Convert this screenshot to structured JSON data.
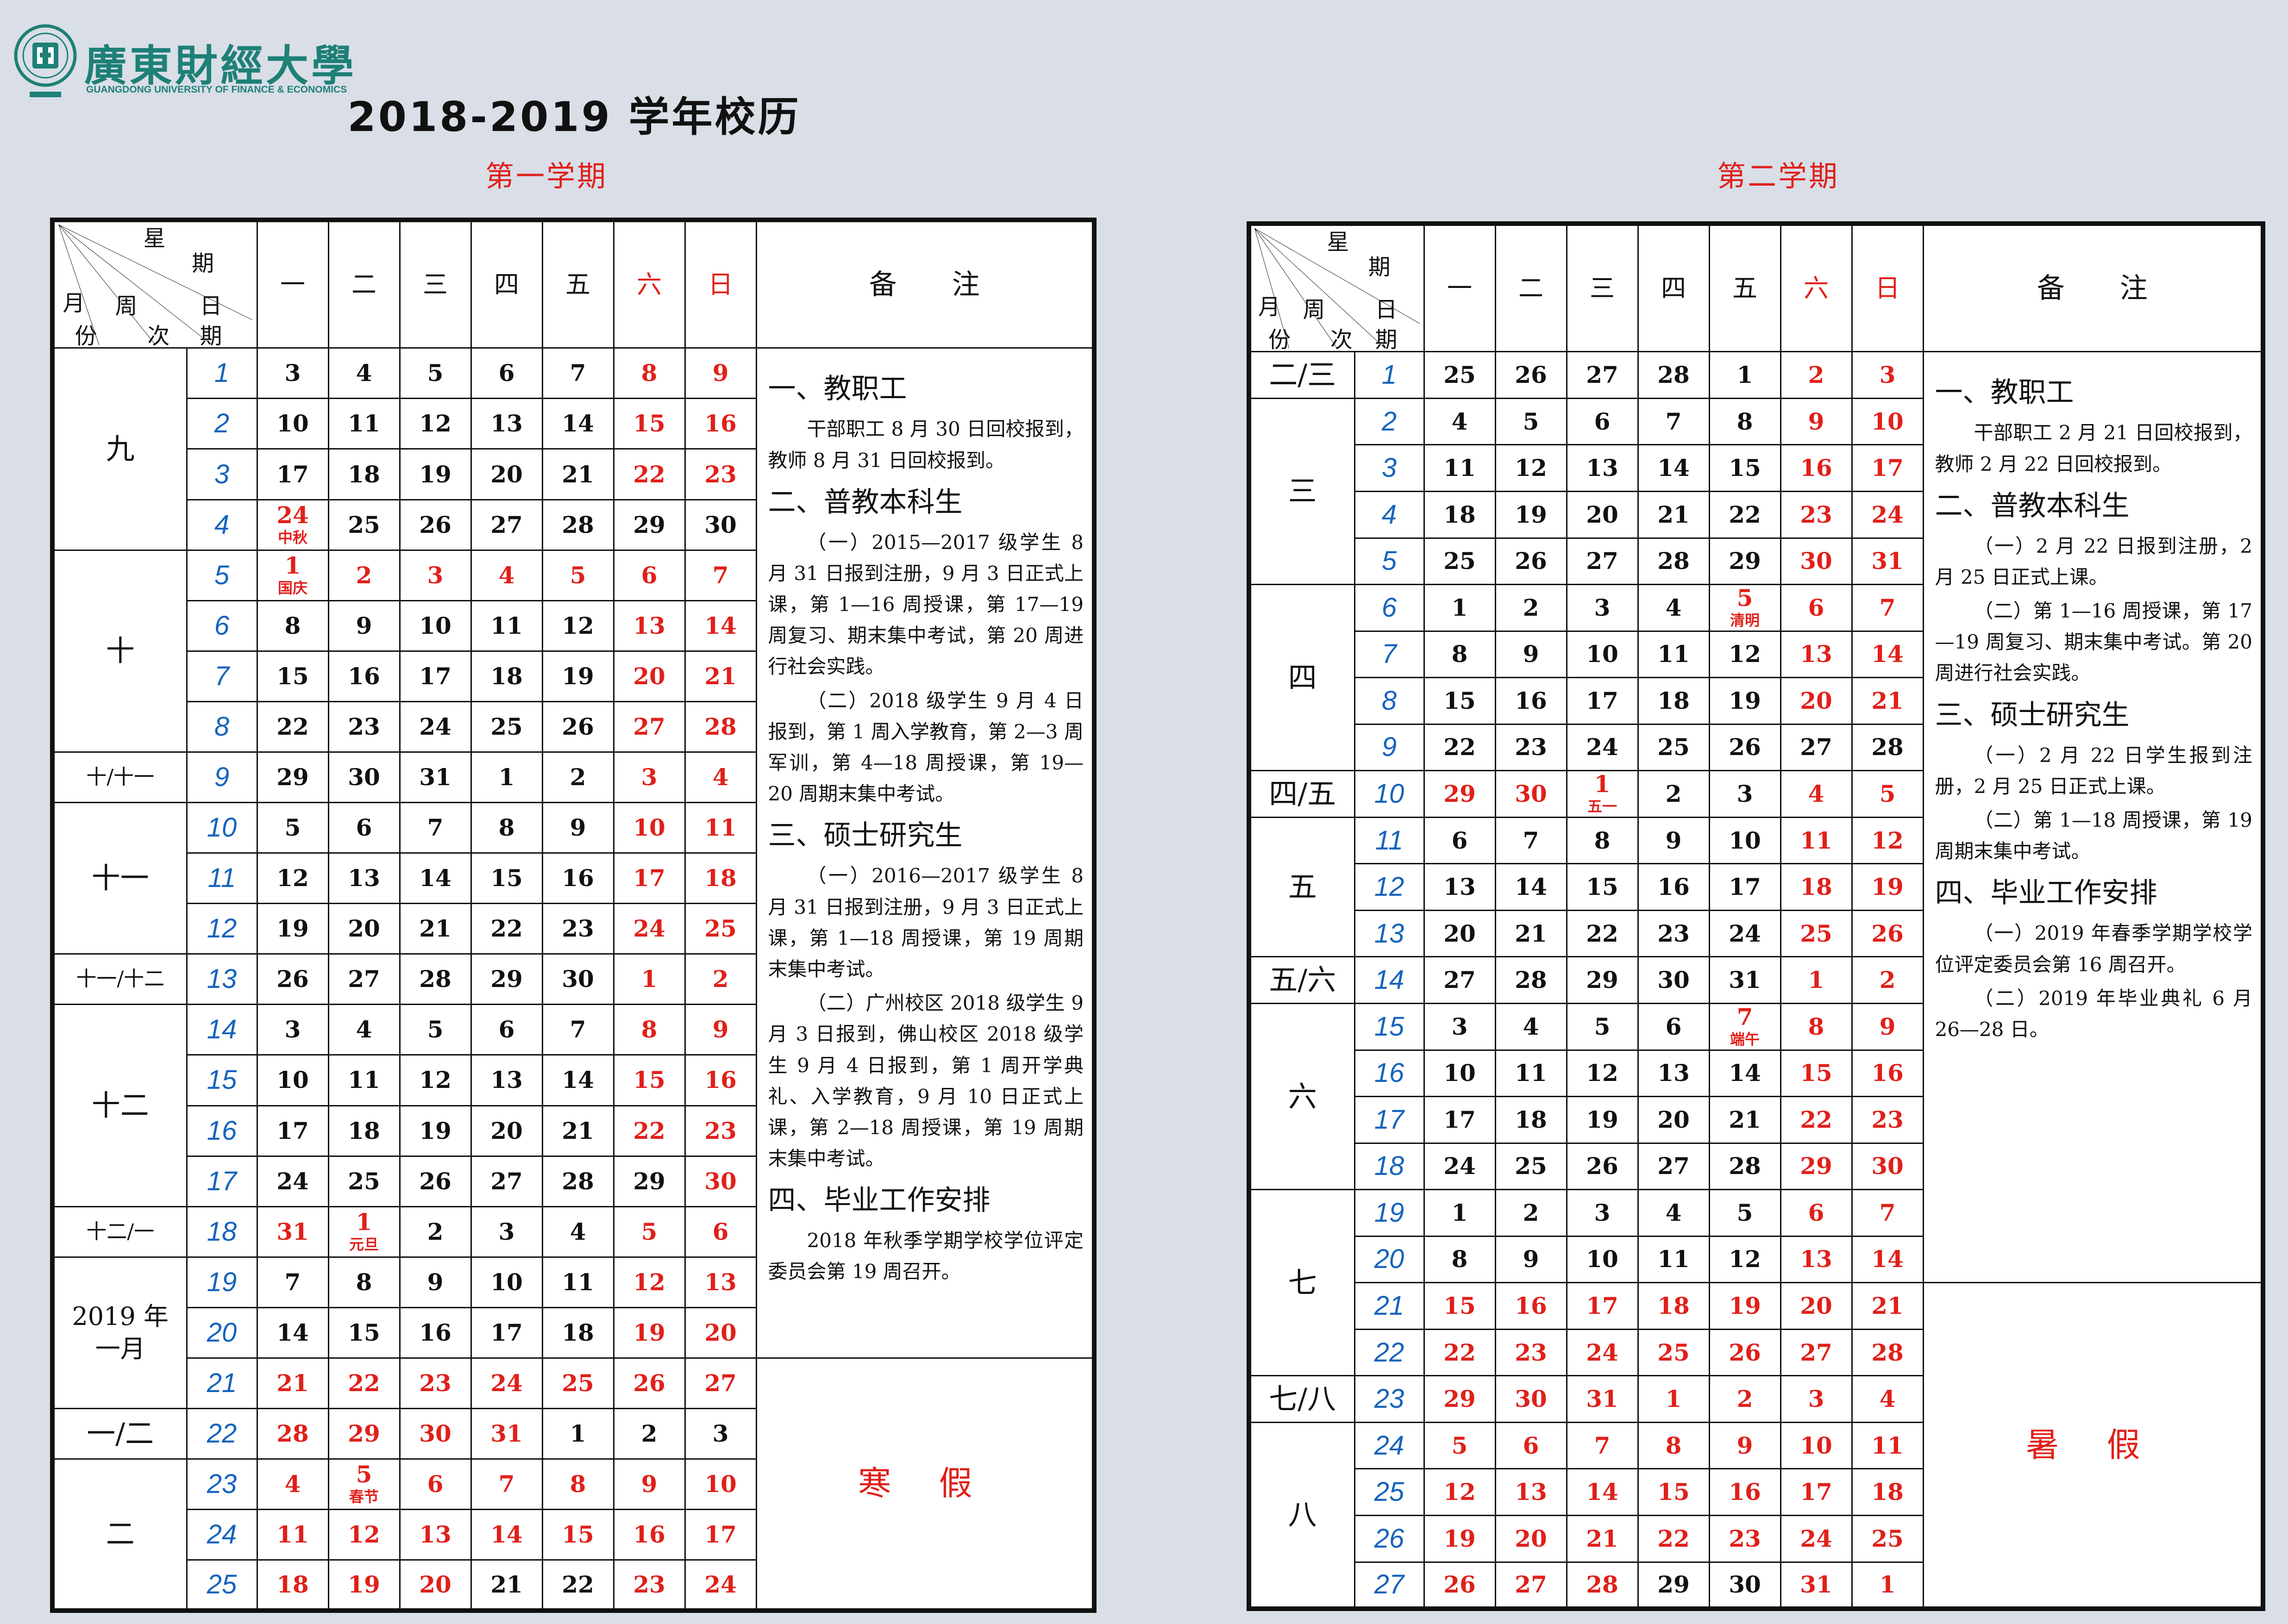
{
  "logo": {
    "cn": "廣東財經大學",
    "en": "GUANGDONG UNIVERSITY OF FINANCE & ECONOMICS",
    "seal_text": "廣東財經大學 1983"
  },
  "title": "2018-2019 学年校历",
  "header": {
    "corner": {
      "xing": "星",
      "qi": "期",
      "ri": "日",
      "yue": "月",
      "fen": "份",
      "zhou": "周",
      "ci": "次",
      "qi2": "期"
    },
    "days": [
      "一",
      "二",
      "三",
      "四",
      "五",
      "六",
      "日"
    ],
    "notes": "备 注"
  },
  "colors": {
    "red": "#e0201a",
    "week_blue": "#1564bd",
    "logo_teal": "#1e8077",
    "text": "#111111",
    "page_bg": "#d9dee7"
  },
  "sem1": {
    "title": "第一学期",
    "rows": [
      {
        "month": "九",
        "week": "1",
        "days": [
          "3",
          "4",
          "5",
          "6",
          "7",
          "8",
          "9"
        ],
        "red": [
          5,
          6
        ]
      },
      {
        "week": "2",
        "days": [
          "10",
          "11",
          "12",
          "13",
          "14",
          "15",
          "16"
        ],
        "red": [
          5,
          6
        ]
      },
      {
        "week": "3",
        "days": [
          "17",
          "18",
          "19",
          "20",
          "21",
          "22",
          "23"
        ],
        "red": [
          5,
          6
        ]
      },
      {
        "week": "4",
        "days": [
          "24",
          "25",
          "26",
          "27",
          "28",
          "29",
          "30"
        ],
        "red": [
          0
        ],
        "ann": {
          "0": "中秋"
        }
      },
      {
        "month": "十",
        "week": "5",
        "days": [
          "1",
          "2",
          "3",
          "4",
          "5",
          "6",
          "7"
        ],
        "red": [
          0,
          1,
          2,
          3,
          4,
          5,
          6
        ],
        "ann": {
          "0": "国庆"
        }
      },
      {
        "week": "6",
        "days": [
          "8",
          "9",
          "10",
          "11",
          "12",
          "13",
          "14"
        ],
        "red": [
          5,
          6
        ]
      },
      {
        "week": "7",
        "days": [
          "15",
          "16",
          "17",
          "18",
          "19",
          "20",
          "21"
        ],
        "red": [
          5,
          6
        ]
      },
      {
        "week": "8",
        "days": [
          "22",
          "23",
          "24",
          "25",
          "26",
          "27",
          "28"
        ],
        "red": [
          5,
          6
        ]
      },
      {
        "month": "十/十一",
        "week": "9",
        "days": [
          "29",
          "30",
          "31",
          "1",
          "2",
          "3",
          "4"
        ],
        "red": [
          5,
          6
        ]
      },
      {
        "month": "十一",
        "week": "10",
        "days": [
          "5",
          "6",
          "7",
          "8",
          "9",
          "10",
          "11"
        ],
        "red": [
          5,
          6
        ]
      },
      {
        "week": "11",
        "days": [
          "12",
          "13",
          "14",
          "15",
          "16",
          "17",
          "18"
        ],
        "red": [
          5,
          6
        ]
      },
      {
        "week": "12",
        "days": [
          "19",
          "20",
          "21",
          "22",
          "23",
          "24",
          "25"
        ],
        "red": [
          5,
          6
        ]
      },
      {
        "month": "十一/十二",
        "week": "13",
        "days": [
          "26",
          "27",
          "28",
          "29",
          "30",
          "1",
          "2"
        ],
        "red": [
          5,
          6
        ]
      },
      {
        "month": "十二",
        "week": "14",
        "days": [
          "3",
          "4",
          "5",
          "6",
          "7",
          "8",
          "9"
        ],
        "red": [
          5,
          6
        ]
      },
      {
        "week": "15",
        "days": [
          "10",
          "11",
          "12",
          "13",
          "14",
          "15",
          "16"
        ],
        "red": [
          5,
          6
        ]
      },
      {
        "week": "16",
        "days": [
          "17",
          "18",
          "19",
          "20",
          "21",
          "22",
          "23"
        ],
        "red": [
          5,
          6
        ]
      },
      {
        "week": "17",
        "days": [
          "24",
          "25",
          "26",
          "27",
          "28",
          "29",
          "30"
        ],
        "red": [
          6
        ]
      },
      {
        "month": "十二/一",
        "week": "18",
        "days": [
          "31",
          "1",
          "2",
          "3",
          "4",
          "5",
          "6"
        ],
        "red": [
          0,
          1,
          5,
          6
        ],
        "ann": {
          "1": "元旦"
        }
      },
      {
        "month": "2019 年 一月",
        "week": "19",
        "days": [
          "7",
          "8",
          "9",
          "10",
          "11",
          "12",
          "13"
        ],
        "red": [
          5,
          6
        ]
      },
      {
        "week": "20",
        "days": [
          "14",
          "15",
          "16",
          "17",
          "18",
          "19",
          "20"
        ],
        "red": [
          5,
          6
        ]
      },
      {
        "week": "21",
        "days": [
          "21",
          "22",
          "23",
          "24",
          "25",
          "26",
          "27"
        ],
        "red": [
          0,
          1,
          2,
          3,
          4,
          5,
          6
        ]
      },
      {
        "month": "一/二",
        "week": "22",
        "days": [
          "28",
          "29",
          "30",
          "31",
          "1",
          "2",
          "3"
        ],
        "red": [
          0,
          1,
          2,
          3
        ]
      },
      {
        "month": "二",
        "week": "23",
        "days": [
          "4",
          "5",
          "6",
          "7",
          "8",
          "9",
          "10"
        ],
        "red": [
          0,
          1,
          2,
          3,
          4,
          5,
          6
        ],
        "ann": {
          "1": "春节"
        }
      },
      {
        "week": "24",
        "days": [
          "11",
          "12",
          "13",
          "14",
          "15",
          "16",
          "17"
        ],
        "red": [
          0,
          1,
          2,
          3,
          4,
          5,
          6
        ]
      },
      {
        "week": "25",
        "days": [
          "18",
          "19",
          "20",
          "21",
          "22",
          "23",
          "24"
        ],
        "red": [
          0,
          1,
          2,
          5,
          6
        ]
      }
    ],
    "notes": [
      {
        "h": "一、教职工",
        "p": [
          "干部职工 8 月 30 日回校报到，教师 8 月 31 日回校报到。"
        ]
      },
      {
        "h": "二、普教本科生",
        "p": [
          "（一）2015—2017 级学生 8 月 31 日报到注册，9 月 3 日正式上课，第 1—16 周授课，第 17—19 周复习、期末集中考试，第 20 周进行社会实践。",
          "（二）2018 级学生 9 月 4 日报到，第 1 周入学教育，第 2—3 周军训，第 4—18 周授课，第 19—20 周期末集中考试。"
        ]
      },
      {
        "h": "三、硕士研究生",
        "p": [
          "（一）2016—2017 级学生 8 月 31 日报到注册，9 月 3 日正式上课，第 1—18 周授课，第 19 周期末集中考试。",
          "（二）广州校区 2018 级学生 9 月 3 日报到，佛山校区 2018 级学生 9 月 4 日报到，第 1 周开学典礼、入学教育，9 月 10 日正式上课，第 2—18 周授课，第 19 周期末集中考试。"
        ]
      },
      {
        "h": "四、毕业工作安排",
        "p": [
          "2018 年秋季学期学校学位评定委员会第 19 周召开。"
        ]
      }
    ],
    "vacation": "寒 假"
  },
  "sem2": {
    "title": "第二学期",
    "rows": [
      {
        "month": "二/三",
        "week": "1",
        "days": [
          "25",
          "26",
          "27",
          "28",
          "1",
          "2",
          "3"
        ],
        "red": [
          5,
          6
        ]
      },
      {
        "month": "三",
        "week": "2",
        "days": [
          "4",
          "5",
          "6",
          "7",
          "8",
          "9",
          "10"
        ],
        "red": [
          5,
          6
        ]
      },
      {
        "week": "3",
        "days": [
          "11",
          "12",
          "13",
          "14",
          "15",
          "16",
          "17"
        ],
        "red": [
          5,
          6
        ]
      },
      {
        "week": "4",
        "days": [
          "18",
          "19",
          "20",
          "21",
          "22",
          "23",
          "24"
        ],
        "red": [
          5,
          6
        ]
      },
      {
        "week": "5",
        "days": [
          "25",
          "26",
          "27",
          "28",
          "29",
          "30",
          "31"
        ],
        "red": [
          5,
          6
        ]
      },
      {
        "month": "四",
        "week": "6",
        "days": [
          "1",
          "2",
          "3",
          "4",
          "5",
          "6",
          "7"
        ],
        "red": [
          4,
          5,
          6
        ],
        "ann": {
          "4": "清明"
        }
      },
      {
        "week": "7",
        "days": [
          "8",
          "9",
          "10",
          "11",
          "12",
          "13",
          "14"
        ],
        "red": [
          5,
          6
        ]
      },
      {
        "week": "8",
        "days": [
          "15",
          "16",
          "17",
          "18",
          "19",
          "20",
          "21"
        ],
        "red": [
          5,
          6
        ]
      },
      {
        "week": "9",
        "days": [
          "22",
          "23",
          "24",
          "25",
          "26",
          "27",
          "28"
        ],
        "red": []
      },
      {
        "month": "四/五",
        "week": "10",
        "days": [
          "29",
          "30",
          "1",
          "2",
          "3",
          "4",
          "5"
        ],
        "red": [
          0,
          1,
          2,
          5,
          6
        ],
        "ann": {
          "2": "五一"
        }
      },
      {
        "month": "五",
        "week": "11",
        "days": [
          "6",
          "7",
          "8",
          "9",
          "10",
          "11",
          "12"
        ],
        "red": [
          5,
          6
        ]
      },
      {
        "week": "12",
        "days": [
          "13",
          "14",
          "15",
          "16",
          "17",
          "18",
          "19"
        ],
        "red": [
          5,
          6
        ]
      },
      {
        "week": "13",
        "days": [
          "20",
          "21",
          "22",
          "23",
          "24",
          "25",
          "26"
        ],
        "red": [
          5,
          6
        ]
      },
      {
        "month": "五/六",
        "week": "14",
        "days": [
          "27",
          "28",
          "29",
          "30",
          "31",
          "1",
          "2"
        ],
        "red": [
          5,
          6
        ]
      },
      {
        "month": "六",
        "week": "15",
        "days": [
          "3",
          "4",
          "5",
          "6",
          "7",
          "8",
          "9"
        ],
        "red": [
          4,
          5,
          6
        ],
        "ann": {
          "4": "端午"
        }
      },
      {
        "week": "16",
        "days": [
          "10",
          "11",
          "12",
          "13",
          "14",
          "15",
          "16"
        ],
        "red": [
          5,
          6
        ]
      },
      {
        "week": "17",
        "days": [
          "17",
          "18",
          "19",
          "20",
          "21",
          "22",
          "23"
        ],
        "red": [
          5,
          6
        ]
      },
      {
        "week": "18",
        "days": [
          "24",
          "25",
          "26",
          "27",
          "28",
          "29",
          "30"
        ],
        "red": [
          5,
          6
        ]
      },
      {
        "month": "七",
        "week": "19",
        "days": [
          "1",
          "2",
          "3",
          "4",
          "5",
          "6",
          "7"
        ],
        "red": [
          5,
          6
        ]
      },
      {
        "week": "20",
        "days": [
          "8",
          "9",
          "10",
          "11",
          "12",
          "13",
          "14"
        ],
        "red": [
          5,
          6
        ]
      },
      {
        "week": "21",
        "days": [
          "15",
          "16",
          "17",
          "18",
          "19",
          "20",
          "21"
        ],
        "red": [
          0,
          1,
          2,
          3,
          4,
          5,
          6
        ]
      },
      {
        "week": "22",
        "days": [
          "22",
          "23",
          "24",
          "25",
          "26",
          "27",
          "28"
        ],
        "red": [
          0,
          1,
          2,
          3,
          4,
          5,
          6
        ]
      },
      {
        "month": "七/八",
        "week": "23",
        "days": [
          "29",
          "30",
          "31",
          "1",
          "2",
          "3",
          "4"
        ],
        "red": [
          0,
          1,
          2,
          3,
          4,
          5,
          6
        ]
      },
      {
        "month": "八",
        "week": "24",
        "days": [
          "5",
          "6",
          "7",
          "8",
          "9",
          "10",
          "11"
        ],
        "red": [
          0,
          1,
          2,
          3,
          4,
          5,
          6
        ]
      },
      {
        "week": "25",
        "days": [
          "12",
          "13",
          "14",
          "15",
          "16",
          "17",
          "18"
        ],
        "red": [
          0,
          1,
          2,
          3,
          4,
          5,
          6
        ]
      },
      {
        "week": "26",
        "days": [
          "19",
          "20",
          "21",
          "22",
          "23",
          "24",
          "25"
        ],
        "red": [
          0,
          1,
          2,
          3,
          4,
          5,
          6
        ]
      },
      {
        "week": "27",
        "days": [
          "26",
          "27",
          "28",
          "29",
          "30",
          "31",
          "1"
        ],
        "red": [
          0,
          1,
          2,
          5,
          6
        ]
      }
    ],
    "notes": [
      {
        "h": "一、教职工",
        "p": [
          "干部职工 2 月 21 日回校报到，教师 2 月 22 日回校报到。"
        ]
      },
      {
        "h": "二、普教本科生",
        "p": [
          "（一）2 月 22 日报到注册，2 月 25 日正式上课。",
          "（二）第 1—16 周授课，第 17—19 周复习、期末集中考试。第 20 周进行社会实践。"
        ]
      },
      {
        "h": "三、硕士研究生",
        "p": [
          "（一）2 月 22 日学生报到注册，2 月 25 日正式上课。",
          "（二）第 1—18 周授课，第 19 周期末集中考试。"
        ]
      },
      {
        "h": "四、毕业工作安排",
        "p": [
          "（一）2019 年春季学期学校学位评定委员会第 16 周召开。",
          "（二）2019 年毕业典礼 6 月 26—28 日。"
        ]
      }
    ],
    "vacation": "暑 假"
  }
}
